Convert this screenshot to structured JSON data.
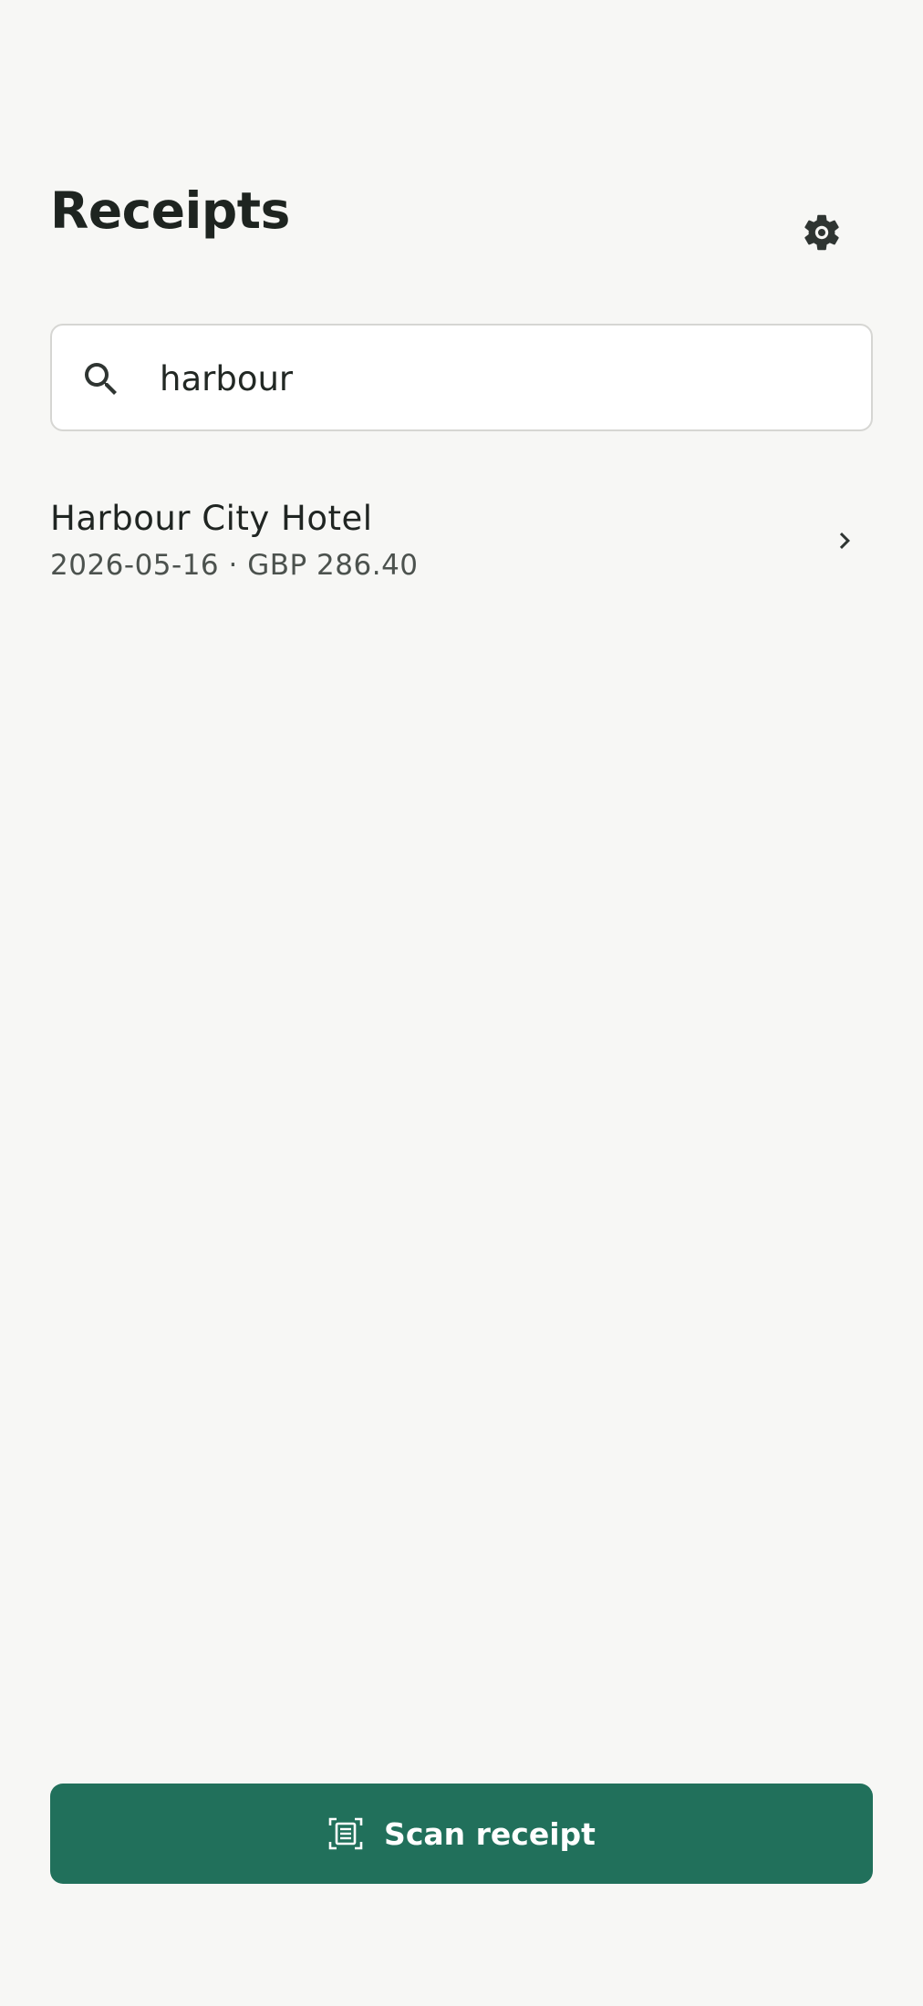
{
  "header": {
    "title": "Receipts",
    "settings_icon": "gear-icon"
  },
  "search": {
    "icon": "search-icon",
    "value": "harbour",
    "placeholder": ""
  },
  "results": [
    {
      "title": "Harbour City Hotel",
      "meta": "2026-05-16 · GBP 286.40",
      "icon": "chevron-right-icon"
    }
  ],
  "scan_button": {
    "label": "Scan receipt",
    "icon": "scan-document-icon"
  },
  "colors": {
    "background": "#f7f7f5",
    "accent": "#21705b",
    "text_primary": "#1e2420",
    "text_secondary": "#4c524e"
  }
}
